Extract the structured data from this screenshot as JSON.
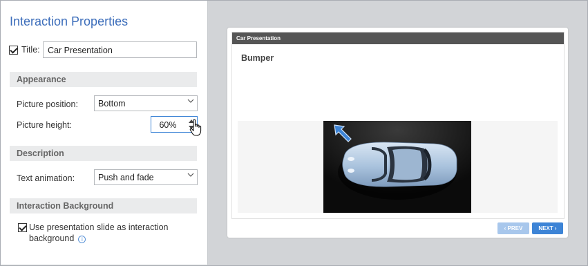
{
  "panel": {
    "title": "Interaction Properties",
    "title_field": {
      "label": "Title:",
      "checked": true,
      "value": "Car Presentation"
    },
    "sections": {
      "appearance": "Appearance",
      "description": "Description",
      "background": "Interaction Background"
    },
    "picture_position": {
      "label": "Picture position:",
      "value": "Bottom"
    },
    "picture_height": {
      "label": "Picture height:",
      "value": "60%"
    },
    "text_animation": {
      "label": "Text animation:",
      "value": "Push and fade"
    },
    "background_option": {
      "checked": true,
      "line1": "Use presentation slide as interaction",
      "line2": "background",
      "info_icon": "i"
    }
  },
  "preview": {
    "header": "Car Presentation",
    "heading": "Bumper",
    "prev": "‹ PREV",
    "next": "NEXT ›"
  },
  "colors": {
    "accent": "#3d84d6",
    "title_blue": "#3d6ebb",
    "workspace": "#d2d4d7",
    "section_bg": "#eaebec"
  }
}
